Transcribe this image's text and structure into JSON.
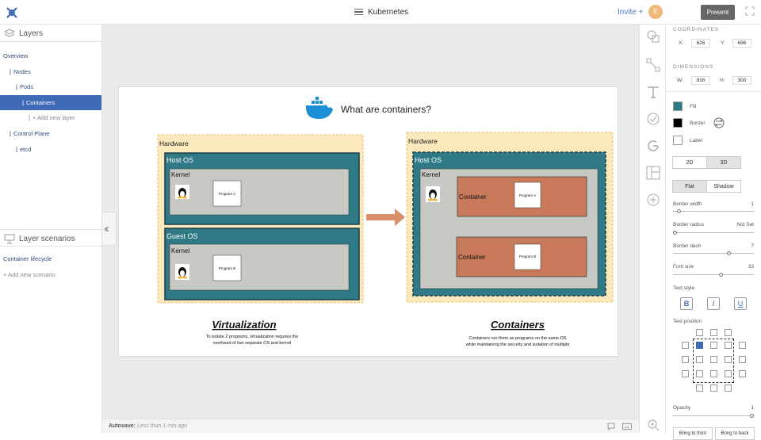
{
  "header": {
    "title": "Kubernetes",
    "invite_label": "Invite +",
    "avatar_initial": "E",
    "present_label": "Present"
  },
  "layers": {
    "title": "Layers",
    "items": [
      {
        "label": "Overview",
        "indent": 0
      },
      {
        "label": "⌊ Nodes",
        "indent": 1
      },
      {
        "label": "⌊ Pods",
        "indent": 2
      },
      {
        "label": "⌊ Containers",
        "indent": 3,
        "selected": true
      },
      {
        "label": "⌊ + Add new layer",
        "indent": 4,
        "add": true
      },
      {
        "label": "⌊ Control Plane",
        "indent": 1
      },
      {
        "label": "⌊ etcd",
        "indent": 2
      }
    ]
  },
  "scenarios": {
    "title": "Layer scenarios",
    "items": [
      {
        "label": "Container lifecycle"
      }
    ],
    "add_label": "+ Add new scenario"
  },
  "status": {
    "label": "Autosave:",
    "value": "Less than 1 min ago"
  },
  "slide": {
    "title": "What are containers?",
    "virt": {
      "hardware": "Hardware",
      "host_os": "Host OS",
      "kernel": "Kernel",
      "guest_os": "Guest OS",
      "kernel2": "Kernel",
      "program_a": "Program A",
      "program_b": "Program B",
      "heading": "Virtualization",
      "caption1": "To isolate 2 programs, virtualization requires the",
      "caption2": "overhead of two separate OS and kernel"
    },
    "cont": {
      "hardware": "Hardware",
      "host_os": "Host OS",
      "kernel": "Kernel",
      "container1": "Container",
      "container2": "Container",
      "program_a": "Program A",
      "program_b": "Program B",
      "heading": "Containers",
      "caption1": "Containers run them as programs on the same OS",
      "caption2": "while maintaining the security and isolation of multiple"
    }
  },
  "props": {
    "coordinates_label": "COORDINATES",
    "x_label": "X:",
    "x": "626",
    "y_label": "Y:",
    "y": "696",
    "dimensions_label": "DIMENSIONS",
    "w_label": "W:",
    "w": "816",
    "h_label": "H:",
    "h": "300",
    "fill_label": "Fill",
    "fill_color": "#2f7a86",
    "border_label": "Border",
    "border_color": "#000000",
    "label_label": "Label",
    "btn_2d": "2D",
    "btn_3d": "3D",
    "btn_flat": "Flat",
    "btn_shadow": "Shadow",
    "border_width_label": "Border width",
    "border_width": "1",
    "border_width_level": 0.05,
    "border_radius_label": "Border radius",
    "border_radius": "Not Set",
    "border_radius_level": 0,
    "border_dash_label": "Border dash",
    "border_dash": "7",
    "border_dash_level": 0.7,
    "font_size_label": "Font size",
    "font_size": "33",
    "font_size_level": 0.6,
    "text_style_label": "Text style",
    "bold": "B",
    "italic": "I",
    "underline": "U",
    "text_position_label": "Text position",
    "opacity_label": "Opacity",
    "opacity": "1",
    "opacity_level": 1.0,
    "bring_front": "Bring to front",
    "bring_back": "Bring to back"
  },
  "colors": {
    "accent": "#3e6ab8",
    "teal": "#2f7a86",
    "container": "#c97a5a",
    "hardware": "#fbe9bd"
  }
}
